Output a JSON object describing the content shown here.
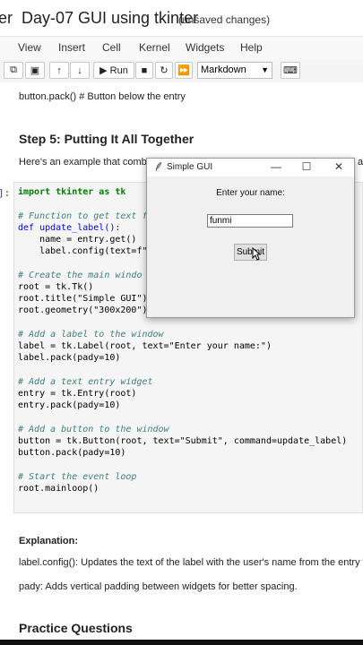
{
  "header": {
    "app_partial": "er",
    "notebook_title": "Day-07 GUI using tkinter",
    "status": "(unsaved changes)"
  },
  "menu": [
    "View",
    "Insert",
    "Cell",
    "Kernel",
    "Widgets",
    "Help"
  ],
  "toolbar": {
    "run_label": "Run",
    "cell_type": "Markdown",
    "icons": [
      "copy-icon",
      "paste-icon",
      "move-up-icon",
      "move-down-icon",
      "run-icon",
      "stop-icon",
      "restart-icon",
      "fast-forward-icon",
      "keyboard-icon"
    ]
  },
  "notebook": {
    "top_line": "button.pack() # Button below the entry",
    "step_heading": "Step 5: Putting It All Together",
    "intro_text": "Here's an example that comb",
    "intro_tail": "a",
    "prompt": "]:",
    "code": {
      "l1": "import tkinter as tk",
      "l2": "# Function to get text f",
      "l3": "def update_label():",
      "l4": "    name = entry.get()",
      "l5": "    label.config(text=f\"",
      "l6": "# Create the main windo",
      "l7": "root = tk.Tk()",
      "l8": "root.title(\"Simple GUI\")",
      "l9": "root.geometry(\"300x200\")",
      "l10": "# Add a label to the window",
      "l11": "label = tk.Label(root, text=\"Enter your name:\")",
      "l12": "label.pack(pady=10)",
      "l13": "# Add a text entry widget",
      "l14": "entry = tk.Entry(root)",
      "l15": "entry.pack(pady=10)",
      "l16": "# Add a button to the window",
      "l17": "button = tk.Button(root, text=\"Submit\", command=update_label)",
      "l18": "button.pack(pady=10)",
      "l19": "# Start the event loop",
      "l20": "root.mainloop()"
    },
    "explanation_heading": "Explanation:",
    "explanation_1": "label.config(): Updates the text of the label with the user's name from the entry w",
    "explanation_2": "pady: Adds vertical padding between widgets for better spacing.",
    "practice_heading": "Practice Questions"
  },
  "tk_window": {
    "title": "Simple GUI",
    "label": "Enter your name:",
    "entry_value": "funmi",
    "button_label": "Submit"
  }
}
